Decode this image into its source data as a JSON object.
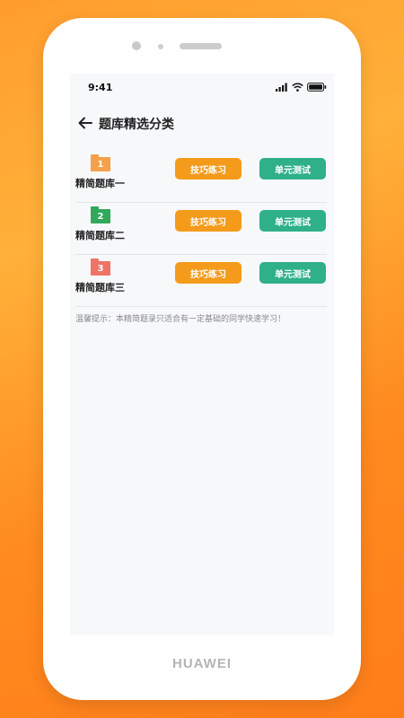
{
  "device": {
    "brand": "HUAWEI"
  },
  "status_bar": {
    "time": "9:41",
    "icons": [
      "signal-icon",
      "wifi-icon",
      "battery-icon"
    ]
  },
  "header": {
    "back_icon": "arrow-left-icon",
    "title": "题库精选分类"
  },
  "banks": [
    {
      "number": "1",
      "name": "精简题库一",
      "folder_color": "#f5a04a",
      "practice_label": "技巧练习",
      "test_label": "单元测试"
    },
    {
      "number": "2",
      "name": "精简题库二",
      "folder_color": "#31a85c",
      "practice_label": "技巧练习",
      "test_label": "单元测试"
    },
    {
      "number": "3",
      "name": "精简题库三",
      "folder_color": "#ee7468",
      "practice_label": "技巧练习",
      "test_label": "单元测试"
    }
  ],
  "tip": "温馨提示：本精简题录只适合有一定基础的同学快速学习！",
  "colors": {
    "practice_button": "#f59b1b",
    "test_button": "#2fb086",
    "background_orange": "#ff9d2e"
  }
}
